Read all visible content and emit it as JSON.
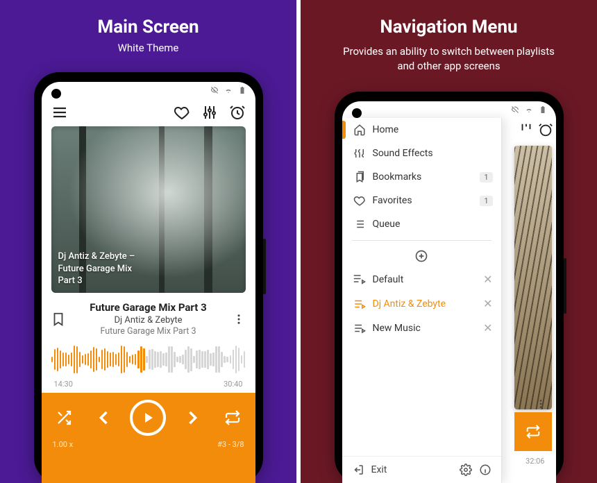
{
  "left": {
    "title": "Main Screen",
    "subtitle": "White Theme",
    "art_overlay": "Dj Antiz & Zebyte –\nFuture Garage Mix\nPart 3",
    "track": {
      "title": "Future Garage Mix Part 3",
      "artist": "Dj Antiz & Zebyte",
      "album": "Future Garage Mix Part 3"
    },
    "waveform": {
      "bars": 70,
      "progress": 0.48,
      "played_color": "#f28c0a",
      "rest_color": "#d6d6d6"
    },
    "time": {
      "elapsed": "14:30",
      "total": "30:40"
    },
    "controls": {
      "speed": "1.00 x",
      "queue": "#3 - 3/8"
    },
    "accent": "#f28c0a"
  },
  "right": {
    "title": "Navigation Menu",
    "desc": "Provides an ability to switch between playlists and other app screens",
    "menu": {
      "home": "Home",
      "effects": "Sound Effects",
      "bookmarks": "Bookmarks",
      "bookmarks_badge": "1",
      "favorites": "Favorites",
      "favorites_badge": "1",
      "queue": "Queue"
    },
    "playlists": {
      "p0": "Default",
      "p1": "Dj Antiz & Zebyte",
      "p2": "New Music",
      "selected_index": 1
    },
    "footer": {
      "exit": "Exit"
    },
    "bg_time": "32:06"
  }
}
